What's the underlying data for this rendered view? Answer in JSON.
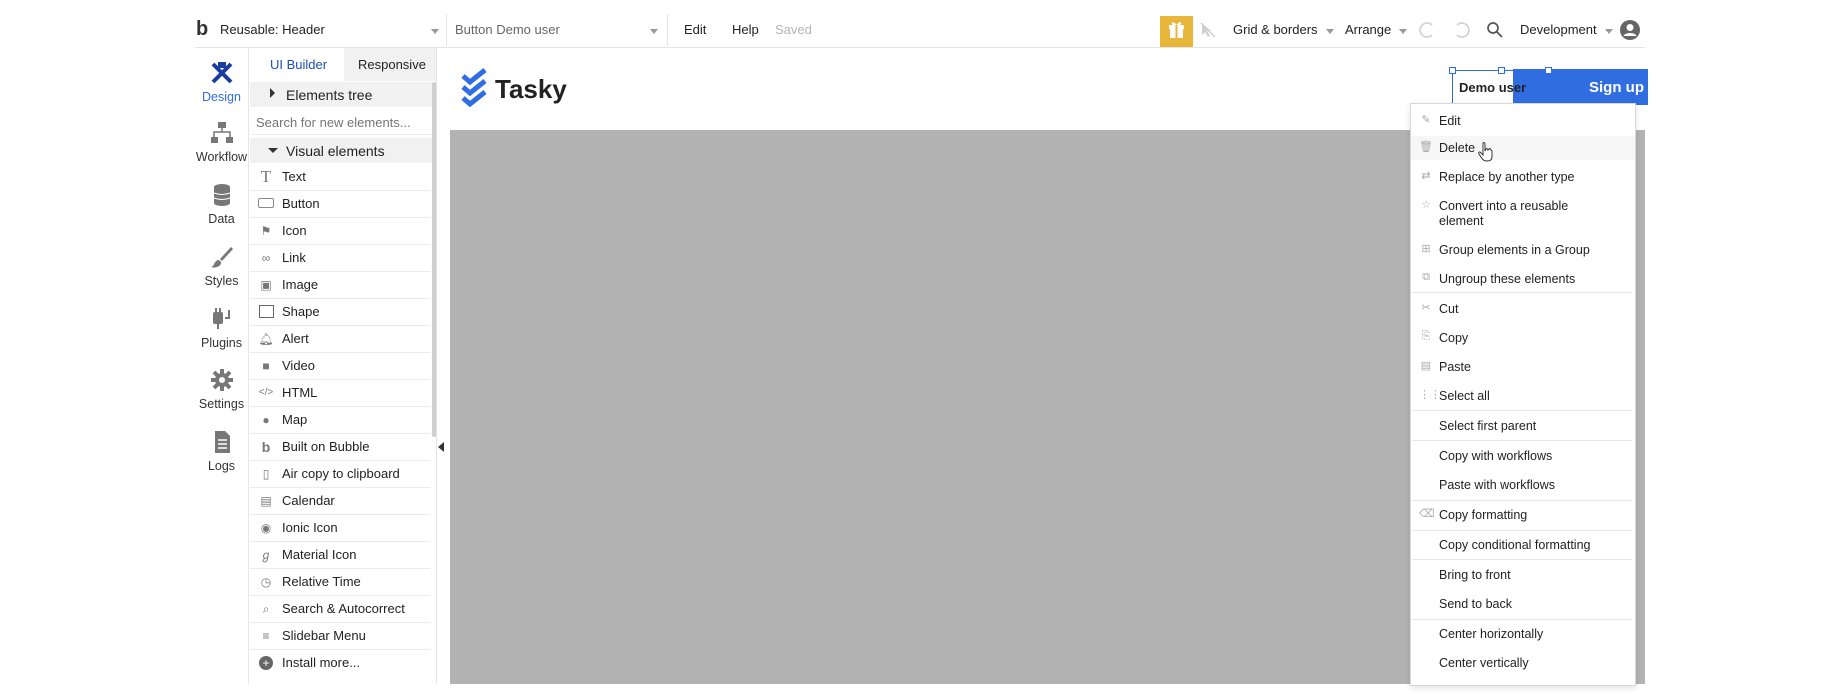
{
  "topbar": {
    "logo_glyph": "b",
    "page_select": "Reusable: Header",
    "element_select": "Button Demo user",
    "menu_edit": "Edit",
    "menu_help": "Help",
    "saved_status": "Saved",
    "grid_borders": "Grid & borders",
    "arrange": "Arrange",
    "version": "Development",
    "gift_color": "#e8b63a"
  },
  "rail": {
    "items": [
      {
        "label": "Design",
        "icon": "design-icon",
        "active": true
      },
      {
        "label": "Workflow",
        "icon": "workflow-icon"
      },
      {
        "label": "Data",
        "icon": "database-icon"
      },
      {
        "label": "Styles",
        "icon": "brush-icon"
      },
      {
        "label": "Plugins",
        "icon": "plug-icon"
      },
      {
        "label": "Settings",
        "icon": "gear-icon"
      },
      {
        "label": "Logs",
        "icon": "document-icon"
      }
    ]
  },
  "panel": {
    "tab_ui_builder": "UI Builder",
    "tab_responsive": "Responsive",
    "elements_tree": "Elements tree",
    "search_placeholder": "Search for new elements...",
    "visual_elements": "Visual elements",
    "elements": [
      {
        "label": "Text",
        "icon": "text-icon"
      },
      {
        "label": "Button",
        "icon": "button-icon"
      },
      {
        "label": "Icon",
        "icon": "flag-icon"
      },
      {
        "label": "Link",
        "icon": "link-icon"
      },
      {
        "label": "Image",
        "icon": "image-icon"
      },
      {
        "label": "Shape",
        "icon": "shape-icon"
      },
      {
        "label": "Alert",
        "icon": "bell-icon"
      },
      {
        "label": "Video",
        "icon": "video-icon"
      },
      {
        "label": "HTML",
        "icon": "code-icon"
      },
      {
        "label": "Map",
        "icon": "map-pin-icon"
      },
      {
        "label": "Built on Bubble",
        "icon": "bubble-icon"
      },
      {
        "label": "Air copy to clipboard",
        "icon": "clipboard-icon"
      },
      {
        "label": "Calendar",
        "icon": "calendar-icon"
      },
      {
        "label": "Ionic Icon",
        "icon": "ionic-icon"
      },
      {
        "label": "Material Icon",
        "icon": "material-icon"
      },
      {
        "label": "Relative Time",
        "icon": "clock-icon"
      },
      {
        "label": "Search & Autocorrect",
        "icon": "search-icon"
      },
      {
        "label": "Slidebar Menu",
        "icon": "menu-icon"
      },
      {
        "label": "Install more...",
        "icon": "plus-circle-icon"
      }
    ]
  },
  "canvas": {
    "logo_text": "Tasky",
    "logo_color": "#2f6de1",
    "selected_text": "Demo user",
    "signup_label": "Sign up",
    "signup_color": "#2f6de1",
    "gray_color": "#b3b3b3"
  },
  "context_menu": {
    "items": [
      {
        "label": "Edit",
        "icon": "edit-icon"
      },
      {
        "label": "Delete",
        "icon": "trash-icon"
      },
      {
        "label": "Replace by another type",
        "icon": "swap-icon"
      },
      {
        "label": "Convert into a reusable element",
        "icon": "star-icon"
      },
      {
        "label": "Group elements in a Group",
        "icon": "group-icon"
      },
      {
        "label": "Ungroup these elements",
        "icon": "ungroup-icon"
      },
      {
        "label": "Cut",
        "icon": "scissors-icon"
      },
      {
        "label": "Copy",
        "icon": "copy-icon"
      },
      {
        "label": "Paste",
        "icon": "paste-icon"
      },
      {
        "label": "Select all",
        "icon": "grid-icon"
      },
      {
        "label": "Select first parent",
        "icon": ""
      },
      {
        "label": "Copy with workflows",
        "icon": ""
      },
      {
        "label": "Paste with workflows",
        "icon": ""
      },
      {
        "label": "Copy formatting",
        "icon": "eraser-icon"
      },
      {
        "label": "Copy conditional formatting",
        "icon": ""
      },
      {
        "label": "Bring to front",
        "icon": ""
      },
      {
        "label": "Send to back",
        "icon": ""
      },
      {
        "label": "Center horizontally",
        "icon": ""
      },
      {
        "label": "Center vertically",
        "icon": ""
      }
    ]
  }
}
